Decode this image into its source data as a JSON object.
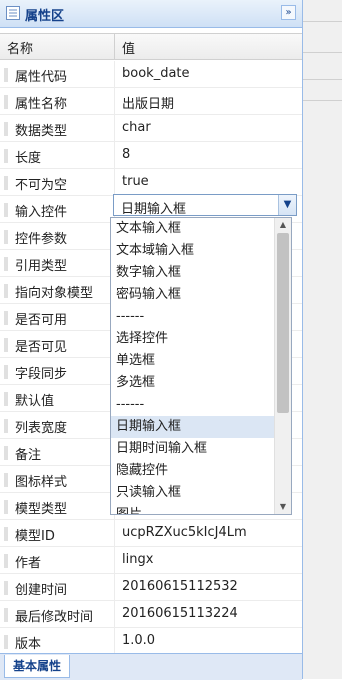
{
  "panel": {
    "title": "属性区",
    "collapse_icon": "double-chevron-right",
    "columns": {
      "name": "名称",
      "value": "值"
    },
    "rows": [
      {
        "name": "属性代码",
        "value": "book_date"
      },
      {
        "name": "属性名称",
        "value": "出版日期"
      },
      {
        "name": "数据类型",
        "value": "char"
      },
      {
        "name": "长度",
        "value": "8"
      },
      {
        "name": "不可为空",
        "value": "true"
      },
      {
        "name": "输入控件",
        "value": ""
      },
      {
        "name": "控件参数",
        "value": ""
      },
      {
        "name": "引用类型",
        "value": ""
      },
      {
        "name": "指向对象模型",
        "value": ""
      },
      {
        "name": "是否可用",
        "value": ""
      },
      {
        "name": "是否可见",
        "value": ""
      },
      {
        "name": "字段同步",
        "value": ""
      },
      {
        "name": "默认值",
        "value": ""
      },
      {
        "name": "列表宽度",
        "value": ""
      },
      {
        "name": "备注",
        "value": ""
      },
      {
        "name": "图标样式",
        "value": ""
      },
      {
        "name": "模型类型",
        "value": ""
      },
      {
        "name": "模型ID",
        "value": "ucpRZXuc5kIcJ4Lm"
      },
      {
        "name": "作者",
        "value": "lingx"
      },
      {
        "name": "创建时间",
        "value": "20160615112532"
      },
      {
        "name": "最后修改时间",
        "value": "20160615113224"
      },
      {
        "name": "版本",
        "value": "1.0.0"
      }
    ],
    "select": {
      "value": "日期输入框",
      "options": [
        "文本输入框",
        "文本域输入框",
        "数字输入框",
        "密码输入框",
        "------",
        "选择控件",
        "单选框",
        "多选框",
        "------",
        "日期输入框",
        "日期时间输入框",
        "隐藏控件",
        "只读输入框",
        "图片"
      ],
      "selected_index": 9
    },
    "tab": "基本属性"
  },
  "colors": {
    "header_text": "#15428b",
    "border": "#99bbe8",
    "selected": "#dbe6f4"
  }
}
